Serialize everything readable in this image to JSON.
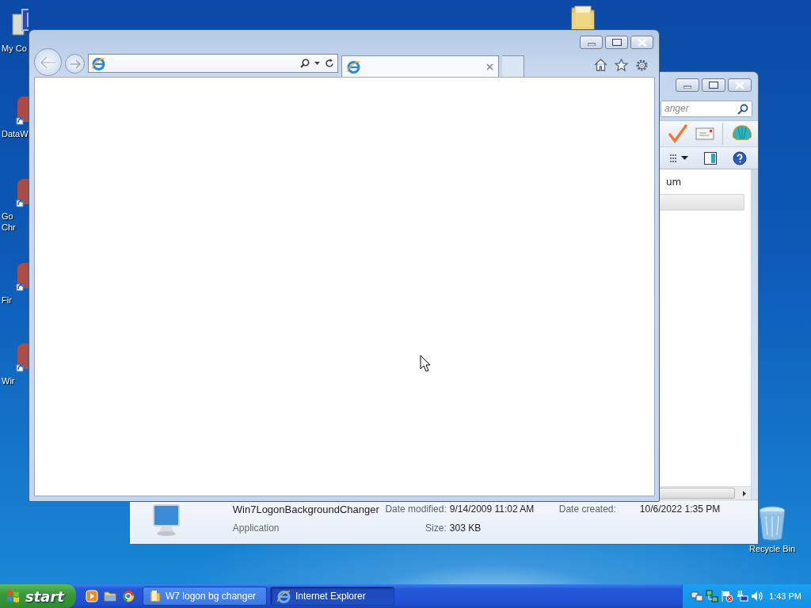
{
  "desktop_icons": [
    {
      "kind": "computer",
      "lines": [
        "My Co"
      ]
    },
    {
      "kind": "shortcut",
      "lines": [
        "DataW"
      ]
    },
    {
      "kind": "shortcut",
      "lines": [
        "Go",
        "Chr"
      ]
    },
    {
      "kind": "shortcut",
      "lines": [
        "Fir"
      ]
    },
    {
      "kind": "shortcut",
      "lines": [
        "Wir"
      ]
    },
    {
      "kind": "recycle_bin",
      "lines": [
        "Recycle Bin"
      ]
    }
  ],
  "explorer": {
    "search": {
      "placeholder": "anger"
    },
    "list_text": "um",
    "details": {
      "name": "Win7LogonBackgroundChanger",
      "type": "Application",
      "fields": [
        {
          "label": "Date modified:",
          "value": "9/14/2009 11:02 AM"
        },
        {
          "label": "Size:",
          "value": "303 KB"
        },
        {
          "label": "Date created:",
          "value": "10/6/2022 1:35 PM"
        }
      ]
    }
  },
  "taskbar": {
    "start": "start",
    "tasks": [
      {
        "kind": "folder",
        "label": "W7 logon bg changer",
        "selected": false
      },
      {
        "kind": "browser",
        "label": "Internet Explorer",
        "selected": true
      }
    ],
    "clock": "1:43 PM"
  }
}
